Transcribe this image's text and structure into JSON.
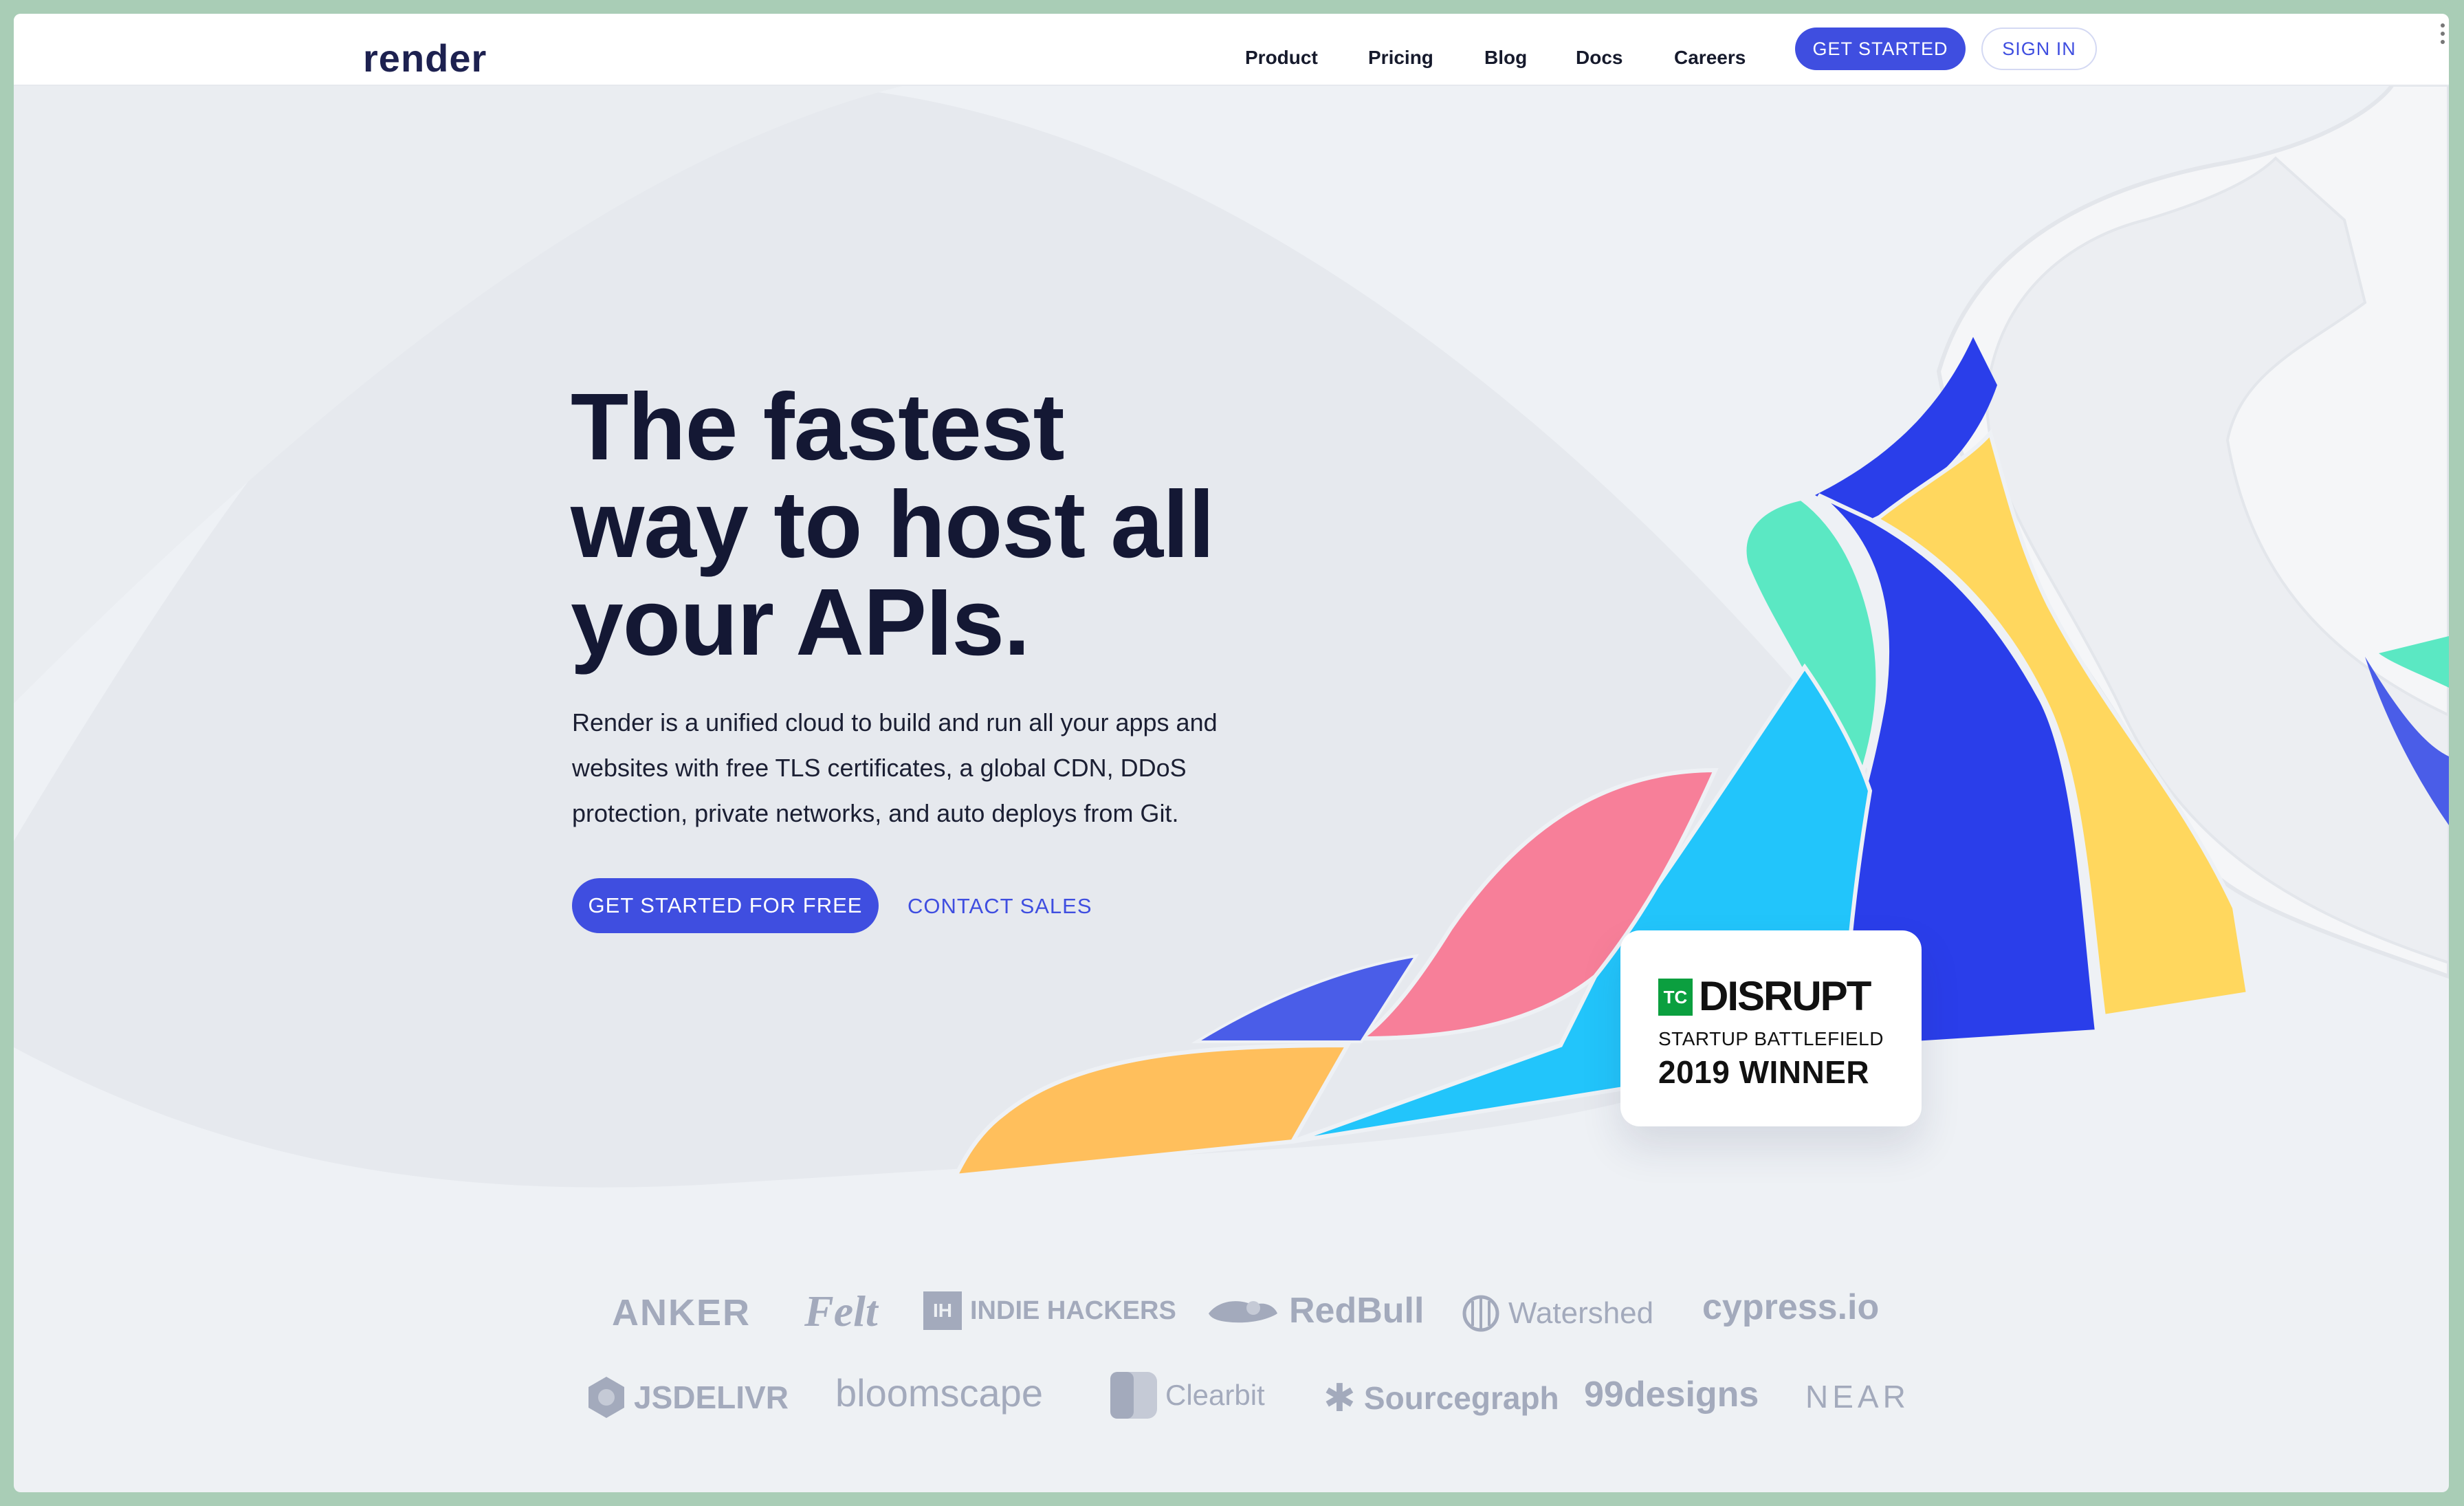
{
  "nav": {
    "logo": "render",
    "links": [
      "Product",
      "Pricing",
      "Blog",
      "Docs",
      "Careers"
    ],
    "get_started": "GET STARTED",
    "sign_in": "SIGN IN"
  },
  "hero": {
    "headline_lines": [
      "The fastest",
      "way to host all",
      "your APIs."
    ],
    "lede": "Render is a unified cloud to build and run all your apps and websites with free TLS certificates, a global CDN, DDoS protection, private networks, and auto deploys from Git.",
    "cta_primary": "GET STARTED FOR FREE",
    "cta_secondary": "CONTACT SALES"
  },
  "badge": {
    "tc": "TC",
    "title": "DISRUPT",
    "subtitle": "STARTUP BATTLEFIELD",
    "winner": "2019 WINNER"
  },
  "customers": {
    "row1": [
      "ANKER",
      "Felt",
      "INDIE HACKERS",
      "RedBull",
      "Watershed",
      "cypress.io"
    ],
    "row2": [
      "JSDELIVR",
      "bloomscape",
      "Clearbit",
      "Sourcegraph",
      "99designs",
      "NEAR"
    ],
    "indie_icon_text": "IH"
  },
  "colors": {
    "brand": "#3f4ee0",
    "text_dark": "#141834",
    "logo_gray": "#a3aabc",
    "art_blue": "#2a3eea",
    "art_yellow": "#ffd75e",
    "art_mint": "#5be8c3",
    "art_sky": "#22c5fb",
    "art_pink": "#f77f99",
    "art_orange": "#ffbf5c"
  }
}
